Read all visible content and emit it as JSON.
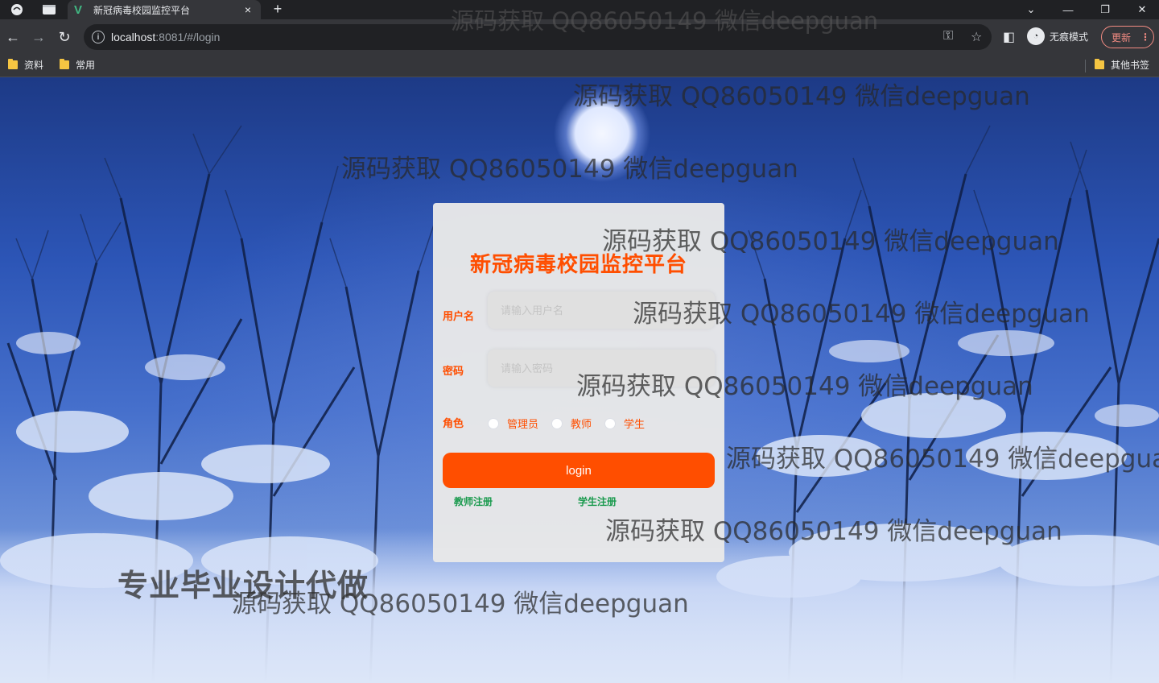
{
  "browser": {
    "tab_title": "新冠病毒校园监控平台",
    "tab_close": "×",
    "new_tab": "+",
    "url_host": "localhost",
    "url_rest": ":8081/#/login",
    "incognito_label": "无痕模式",
    "update_label": "更新",
    "bookmarks": [
      "资料",
      "常用"
    ],
    "other_bookmarks": "其他书签"
  },
  "login": {
    "title": "新冠病毒校园监控平台",
    "username_label": "用户名",
    "username_placeholder": "请输入用户名",
    "password_label": "密码",
    "password_placeholder": "请输入密码",
    "role_label": "角色",
    "roles": [
      "管理员",
      "教师",
      "学生"
    ],
    "login_button": "login",
    "register_teacher": "教师注册",
    "register_student": "学生注册"
  },
  "watermark": {
    "text": "源码获取 QQ86050149 微信deepguan",
    "ad": "专业毕业设计代做"
  },
  "colors": {
    "accent": "#ff4e00",
    "link": "#1a9a4e",
    "card_bg": "#e8e8e8"
  }
}
